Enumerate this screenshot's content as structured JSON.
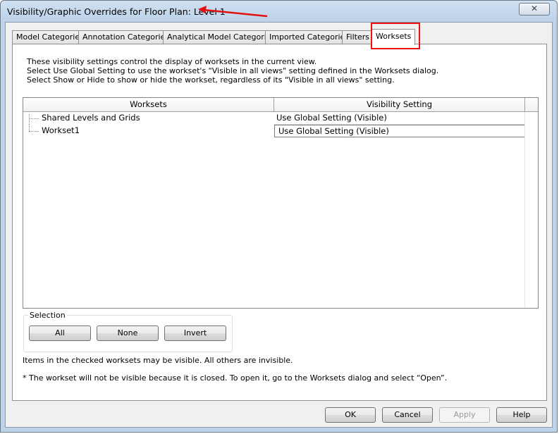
{
  "window": {
    "title": "Visibility/Graphic Overrides for Floor Plan: Level 1",
    "close_glyph": "✕"
  },
  "tabs": [
    {
      "label": "Model Categories"
    },
    {
      "label": "Annotation Categories"
    },
    {
      "label": "Analytical Model Categories"
    },
    {
      "label": "Imported Categories"
    },
    {
      "label": "Filters"
    },
    {
      "label": "Worksets",
      "active": true
    }
  ],
  "description": {
    "line1": "These visibility settings control the display of worksets in the current view.",
    "line2": "Select Use Global Setting to use the workset's \"Visible in all views\" setting defined in the Worksets dialog.",
    "line3": "Select Show or Hide to show or hide the workset, regardless of its \"Visible in all views\" setting."
  },
  "grid": {
    "columns": [
      "Worksets",
      "Visibility Setting"
    ],
    "rows": [
      {
        "workset": "Shared Levels and Grids",
        "visibility": "Use Global Setting (Visible)"
      },
      {
        "workset": "Workset1",
        "visibility": "Use Global Setting (Visible)"
      }
    ]
  },
  "selection": {
    "label": "Selection",
    "all": "All",
    "none": "None",
    "invert": "Invert"
  },
  "notes": {
    "checked": "Items in the checked worksets may be visible.  All others are invisible.",
    "closed": "* The workset will not be visible because it is closed. To open it, go to the Worksets dialog and select “Open”."
  },
  "footer": {
    "ok": "OK",
    "cancel": "Cancel",
    "apply": "Apply",
    "help": "Help"
  },
  "colors": {
    "annotation_red": "#e11111",
    "titlebar": "#bcd3ea"
  }
}
